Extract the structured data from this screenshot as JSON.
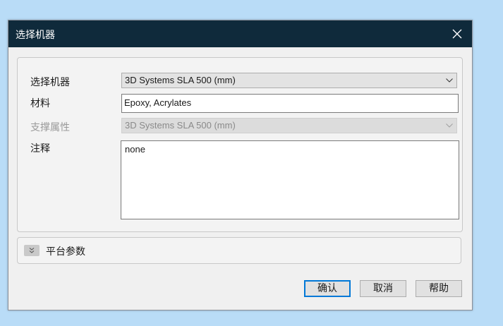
{
  "dialog": {
    "title": "选择机器"
  },
  "form": {
    "machine": {
      "label": "选择机器",
      "value": "3D Systems SLA 500 (mm)"
    },
    "material": {
      "label": "材料",
      "value": "Epoxy, Acrylates"
    },
    "support": {
      "label": "支撑属性",
      "value": "3D Systems SLA 500 (mm)"
    },
    "notes": {
      "label": "注释",
      "value": "none"
    }
  },
  "platform": {
    "label": "平台参数"
  },
  "buttons": {
    "ok": "确认",
    "cancel": "取消",
    "help": "帮助"
  },
  "colors": {
    "titlebar": "#0f2a3b",
    "desktop": "#b9dcf7",
    "default_button_border": "#0078d7"
  },
  "icons": {
    "close": "close-icon",
    "dropdown": "chevron-down-icon",
    "expand": "double-chevron-down-icon"
  }
}
